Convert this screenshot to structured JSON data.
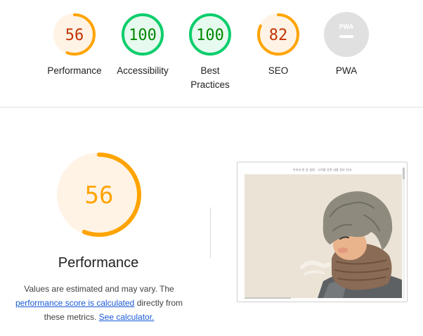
{
  "categories": [
    {
      "id": "performance",
      "score": "56",
      "label": "Performance",
      "status": "average"
    },
    {
      "id": "accessibility",
      "score": "100",
      "label": "Accessibility",
      "status": "pass"
    },
    {
      "id": "best-practices",
      "score": "100",
      "label": "Best Practices",
      "status": "pass"
    },
    {
      "id": "seo",
      "score": "82",
      "label": "SEO",
      "status": "average"
    },
    {
      "id": "pwa",
      "score": "PWA",
      "label": "PWA",
      "status": "na"
    }
  ],
  "performance_detail": {
    "score": "56",
    "title": "Performance",
    "desc_part1": "Values are estimated and may vary. The",
    "link_score": "performance score is calculated",
    "desc_part2": "directly from",
    "desc_part3": "these metrics.",
    "link_calc": "See calculator."
  },
  "screenshot": {
    "caption": "이미지 한 장 설명 · 고려할 만한 내용 정보 안내"
  },
  "colors": {
    "average": "#ffa400",
    "average_bg": "#fff3e6",
    "average_text": "#c33300",
    "pass": "#0cce6b",
    "pass_bg": "#e6faef",
    "pass_text": "#008800",
    "na": "#e0e0e0"
  }
}
